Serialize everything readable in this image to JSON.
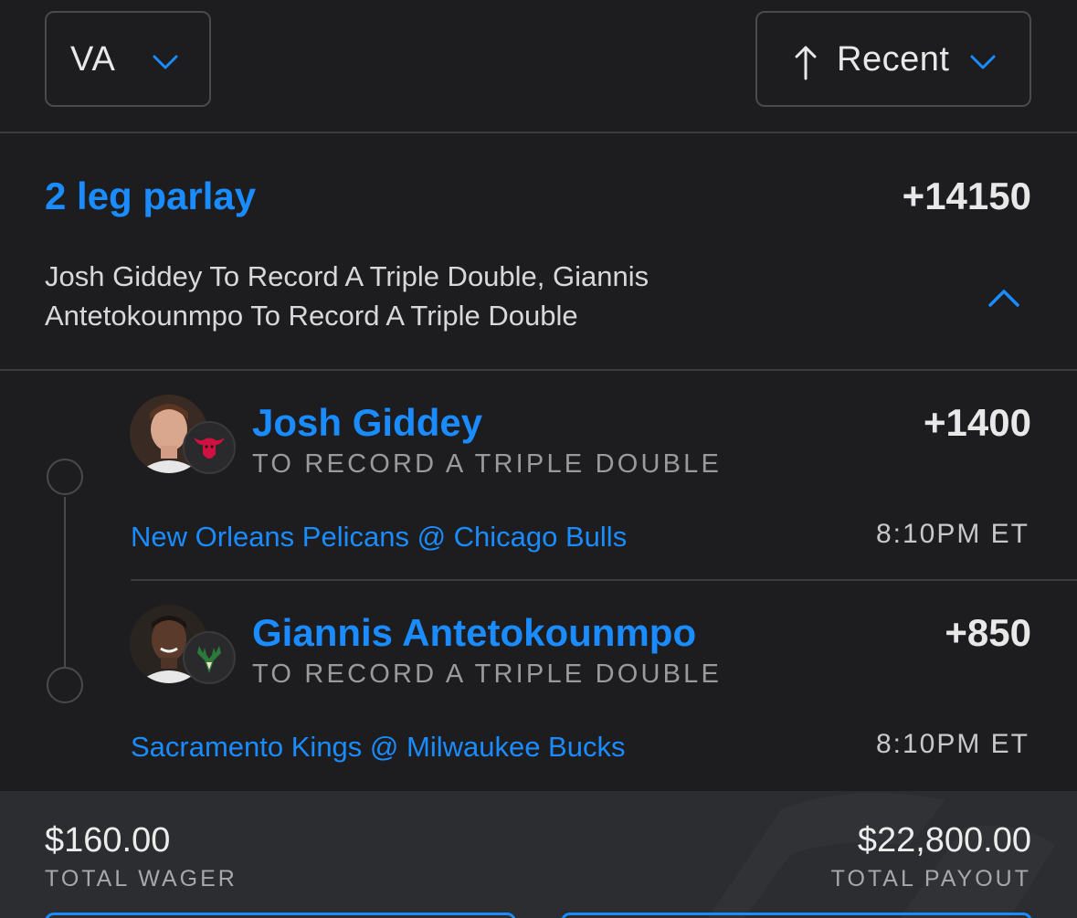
{
  "filters": {
    "state": "VA",
    "sort": "Recent"
  },
  "parlay": {
    "title": "2 leg parlay",
    "odds": "+14150",
    "description": "Josh Giddey To Record A Triple Double, Giannis Antetokounmpo To Record A Triple Double"
  },
  "legs": [
    {
      "player": "Josh Giddey",
      "market": "TO RECORD A TRIPLE DOUBLE",
      "odds": "+1400",
      "matchup": "New Orleans Pelicans @ Chicago Bulls",
      "time": "8:10PM ET",
      "team_icon": "bulls-logo-icon"
    },
    {
      "player": "Giannis Antetokounmpo",
      "market": "TO RECORD A TRIPLE DOUBLE",
      "odds": "+850",
      "matchup": "Sacramento Kings @ Milwaukee Bucks",
      "time": "8:10PM ET",
      "team_icon": "bucks-logo-icon"
    }
  ],
  "totals": {
    "wager": "$160.00",
    "wager_label": "TOTAL WAGER",
    "payout": "$22,800.00",
    "payout_label": "TOTAL PAYOUT"
  },
  "colors": {
    "accent": "#1a8cff",
    "background": "#1d1d1f",
    "footer": "#2b2d30"
  }
}
